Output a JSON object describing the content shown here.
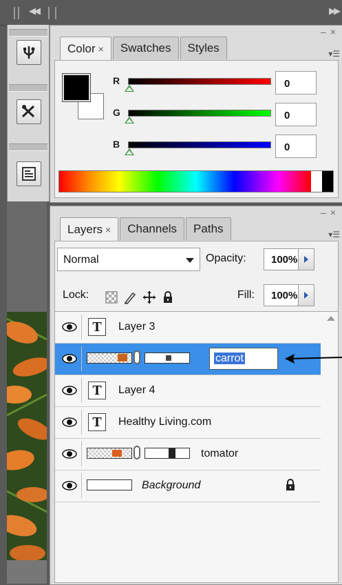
{
  "color_panel": {
    "tabs": [
      {
        "label": "Color",
        "active": true
      },
      {
        "label": "Swatches",
        "active": false
      },
      {
        "label": "Styles",
        "active": false
      }
    ],
    "foreground": "#000000",
    "background": "#ffffff",
    "channels": [
      {
        "label": "R",
        "value": "0",
        "color": "#ff0000"
      },
      {
        "label": "G",
        "value": "0",
        "color": "#00ff00"
      },
      {
        "label": "B",
        "value": "0",
        "color": "#0000ff"
      }
    ]
  },
  "layers_panel": {
    "tabs": [
      {
        "label": "Layers",
        "active": true
      },
      {
        "label": "Channels",
        "active": false
      },
      {
        "label": "Paths",
        "active": false
      }
    ],
    "blend_mode": "Normal",
    "opacity_label": "Opacity:",
    "opacity": "100%",
    "lock_label": "Lock:",
    "fill_label": "Fill:",
    "fill": "100%",
    "layers": [
      {
        "name": "Layer 3",
        "type": "text",
        "selected": false
      },
      {
        "name": "carrot",
        "type": "image-mask",
        "selected": true,
        "editing": true
      },
      {
        "name": "Layer 4",
        "type": "text",
        "selected": false
      },
      {
        "name": "Healthy Living.com",
        "type": "text",
        "selected": false
      },
      {
        "name": "tomator",
        "type": "image-mask",
        "selected": false
      },
      {
        "name": "Background",
        "type": "background",
        "selected": false,
        "locked": true
      }
    ]
  },
  "colors": {
    "selection": "#3a8fe8",
    "annotation_arrow": "#000000"
  }
}
